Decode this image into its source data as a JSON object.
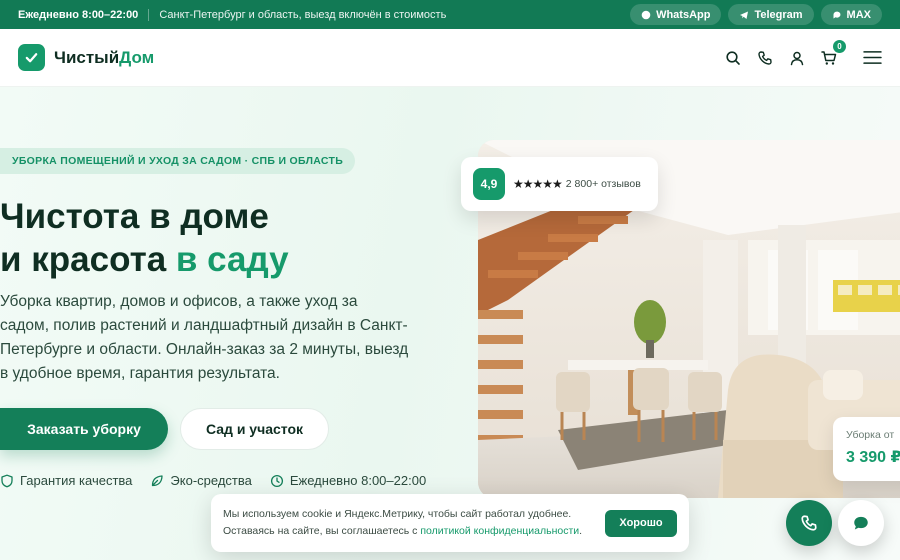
{
  "topbar": {
    "hours": "Ежедневно 8:00–22:00",
    "region": "Санкт-Петербург и область, выезд включён в стоимость",
    "messengers": [
      {
        "label": "WhatsApp",
        "icon": "whatsapp-icon"
      },
      {
        "label": "Telegram",
        "icon": "telegram-icon"
      },
      {
        "label": "MAX",
        "icon": "max-icon"
      }
    ]
  },
  "header": {
    "logo_main": "Чистый",
    "logo_accent": "Дом",
    "cart_count": "0",
    "icons": [
      "search-icon",
      "phone-icon",
      "user-icon",
      "cart-icon",
      "menu-icon"
    ]
  },
  "hero": {
    "tagline": "УБОРКА ПОМЕЩЕНИЙ И УХОД ЗА САДОМ · СПБ И ОБЛАСТЬ",
    "title_line1": "Чистота в доме",
    "title_line2_prefix": "и красота ",
    "title_line2_accent": "в саду",
    "lead": "Уборка квартир, домов и офисов, а также уход за садом, полив растений и ландшафтный дизайн в Санкт-Петербурге и области. Онлайн-заказ за 2 минуты, выезд в удобное время, гарантия результата.",
    "cta_primary": "Заказать уборку",
    "cta_secondary": "Сад и участок",
    "features": [
      {
        "label": "Гарантия качества",
        "icon": "shield-icon"
      },
      {
        "label": "Эко-средства",
        "icon": "leaf-icon"
      },
      {
        "label": "Ежедневно 8:00–22:00",
        "icon": "clock-icon"
      }
    ]
  },
  "rating": {
    "score": "4,9",
    "stars": "★★★★★",
    "reviews": "2 800+ отзывов"
  },
  "price": {
    "label": "Уборка от",
    "value": "3 390 ₽"
  },
  "cookie": {
    "line1": "Мы используем cookie и Яндекс.Метрику, чтобы сайт работал удобнее.",
    "line2_prefix": "Оставаясь на сайте, вы соглашаетесь с ",
    "link": "политикой конфиденциальности",
    "line2_suffix": ".",
    "ok": "Хорошо"
  },
  "colors": {
    "brand": "#169a6b",
    "brand_dark": "#127a55"
  }
}
